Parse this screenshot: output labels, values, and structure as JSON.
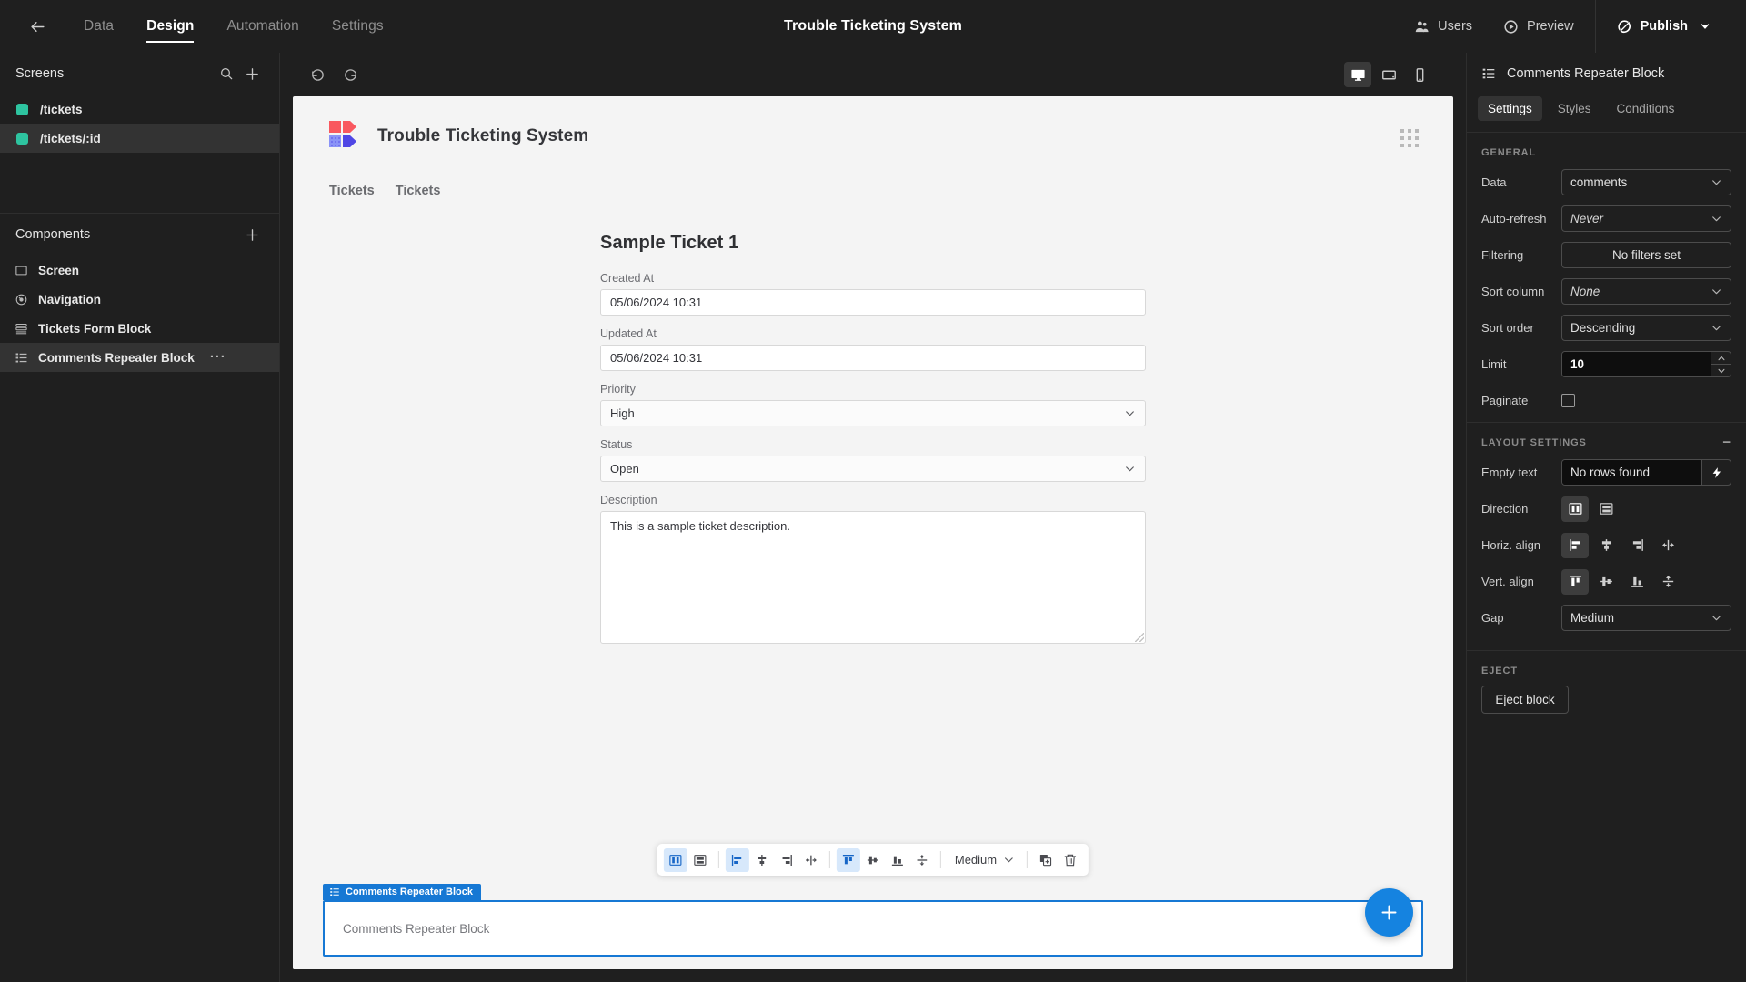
{
  "topbar": {
    "back_icon": "arrow-left-icon",
    "tabs": [
      {
        "label": "Data",
        "active": false
      },
      {
        "label": "Design",
        "active": true
      },
      {
        "label": "Automation",
        "active": false
      },
      {
        "label": "Settings",
        "active": false
      }
    ],
    "title": "Trouble Ticketing System",
    "users_label": "Users",
    "preview_label": "Preview",
    "publish_label": "Publish"
  },
  "left_panel": {
    "screens_title": "Screens",
    "screens": [
      {
        "label": "/tickets",
        "color": "#2ec4a0",
        "selected": false
      },
      {
        "label": "/tickets/:id",
        "color": "#2ec4a0",
        "selected": true
      }
    ],
    "components_title": "Components",
    "components": [
      {
        "label": "Screen",
        "icon": "screen-icon",
        "selected": false
      },
      {
        "label": "Navigation",
        "icon": "navigation-icon",
        "selected": false
      },
      {
        "label": "Tickets Form Block",
        "icon": "form-block-icon",
        "selected": false
      },
      {
        "label": "Comments Repeater Block",
        "icon": "repeater-icon",
        "selected": true,
        "more": "···"
      }
    ]
  },
  "center": {
    "undo_icon": "undo-icon",
    "redo_icon": "redo-icon",
    "devices": [
      {
        "name": "desktop",
        "active": true
      },
      {
        "name": "tablet",
        "active": false
      },
      {
        "name": "mobile",
        "active": false
      }
    ],
    "app_name": "Trouble Ticketing System",
    "app_nav": [
      "Tickets",
      "Tickets"
    ],
    "form": {
      "title": "Sample Ticket 1",
      "fields": [
        {
          "label": "Created At",
          "value": "05/06/2024 10:31",
          "type": "text"
        },
        {
          "label": "Updated At",
          "value": "05/06/2024 10:31",
          "type": "text"
        },
        {
          "label": "Priority",
          "value": "High",
          "type": "select"
        },
        {
          "label": "Status",
          "value": "Open",
          "type": "select"
        },
        {
          "label": "Description",
          "value": "This is a sample ticket description.",
          "type": "textarea"
        }
      ]
    },
    "float_toolbar": {
      "direction": [
        {
          "icon": "direction-column-icon",
          "active": true
        },
        {
          "icon": "direction-row-icon",
          "active": false
        }
      ],
      "horiz_align": [
        {
          "icon": "align-left-icon",
          "active": true
        },
        {
          "icon": "align-center-icon",
          "active": false
        },
        {
          "icon": "align-right-icon",
          "active": false
        },
        {
          "icon": "align-stretch-icon",
          "active": false
        }
      ],
      "vert_align": [
        {
          "icon": "valign-top-icon",
          "active": true
        },
        {
          "icon": "valign-middle-icon",
          "active": false
        },
        {
          "icon": "valign-bottom-icon",
          "active": false
        },
        {
          "icon": "valign-stretch-icon",
          "active": false
        }
      ],
      "gap_value": "Medium",
      "duplicate_icon": "duplicate-icon",
      "delete_icon": "trash-icon"
    },
    "repeater": {
      "tag_label": "Comments Repeater Block",
      "placeholder": "Comments Repeater Block"
    },
    "fab_icon": "plus-icon"
  },
  "right_panel": {
    "header_title": "Comments Repeater Block",
    "header_icon": "repeater-icon",
    "tabs": [
      {
        "label": "Settings",
        "active": true
      },
      {
        "label": "Styles",
        "active": false
      },
      {
        "label": "Conditions",
        "active": false
      }
    ],
    "general_label": "GENERAL",
    "general": {
      "data_label": "Data",
      "data_value": "comments",
      "autorefresh_label": "Auto-refresh",
      "autorefresh_value": "Never",
      "filtering_label": "Filtering",
      "filtering_value": "No filters set",
      "sort_column_label": "Sort column",
      "sort_column_value": "None",
      "sort_order_label": "Sort order",
      "sort_order_value": "Descending",
      "limit_label": "Limit",
      "limit_value": "10",
      "paginate_label": "Paginate",
      "paginate_checked": false
    },
    "layout_label": "LAYOUT SETTINGS",
    "layout": {
      "empty_text_label": "Empty text",
      "empty_text_value": "No rows found",
      "direction_label": "Direction",
      "direction_options": [
        {
          "icon": "direction-column-icon",
          "active": true
        },
        {
          "icon": "direction-row-icon",
          "active": false
        }
      ],
      "horiz_label": "Horiz. align",
      "horiz_options": [
        {
          "icon": "align-left-icon",
          "active": true
        },
        {
          "icon": "align-center-icon",
          "active": false
        },
        {
          "icon": "align-right-icon",
          "active": false
        },
        {
          "icon": "align-stretch-icon",
          "active": false
        }
      ],
      "vert_label": "Vert. align",
      "vert_options": [
        {
          "icon": "valign-top-icon",
          "active": true
        },
        {
          "icon": "valign-middle-icon",
          "active": false
        },
        {
          "icon": "valign-bottom-icon",
          "active": false
        },
        {
          "icon": "valign-stretch-icon",
          "active": false
        }
      ],
      "gap_label": "Gap",
      "gap_value": "Medium"
    },
    "eject_label": "EJECT",
    "eject_button": "Eject block"
  },
  "colors": {
    "accent_blue": "#1583e0",
    "selection_blue": "#1678d4",
    "screen_green": "#2ec4a0",
    "logo_red": "#f9585f",
    "logo_purple": "#4f46e5",
    "panel_bg": "#1f1f1f",
    "canvas_bg": "#f4f4f4"
  }
}
